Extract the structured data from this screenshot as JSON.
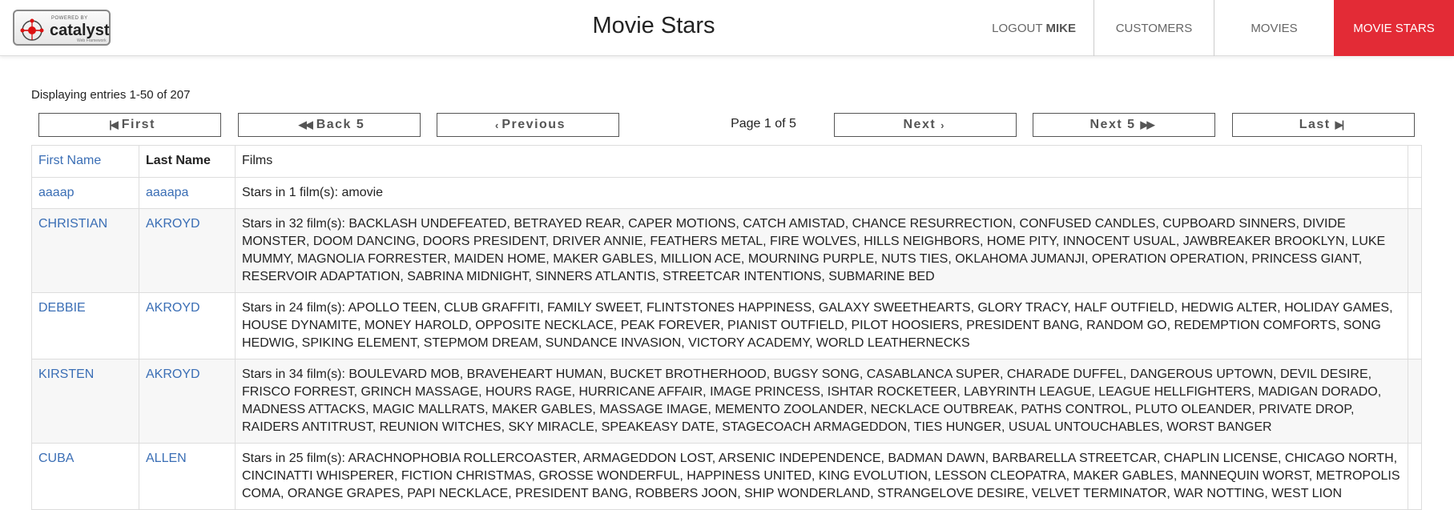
{
  "header": {
    "logo": {
      "powered": "POWERED BY",
      "name": "catalyst",
      "sub": "Web Framework"
    },
    "title": "Movie Stars",
    "nav": {
      "logout": "LOGOUT",
      "user": "MIKE",
      "customers": "CUSTOMERS",
      "movies": "MOVIES",
      "movie_stars": "MOVIE STARS"
    }
  },
  "summary": "Displaying entries 1-50 of 207",
  "pager": {
    "first": "First",
    "back5": "Back 5",
    "previous": "Previous",
    "page_label": "Page 1 of 5",
    "next": "Next",
    "next5": "Next 5",
    "last": "Last"
  },
  "table": {
    "headers": {
      "first_name": "First Name",
      "last_name": "Last Name",
      "films": "Films"
    },
    "rows": [
      {
        "first": "aaaap",
        "last": "aaaapa",
        "films": "Stars in 1 film(s): amovie"
      },
      {
        "first": "CHRISTIAN",
        "last": "AKROYD",
        "films": "Stars in 32 film(s): BACKLASH UNDEFEATED, BETRAYED REAR, CAPER MOTIONS, CATCH AMISTAD, CHANCE RESURRECTION, CONFUSED CANDLES, CUPBOARD SINNERS, DIVIDE MONSTER, DOOM DANCING, DOORS PRESIDENT, DRIVER ANNIE, FEATHERS METAL, FIRE WOLVES, HILLS NEIGHBORS, HOME PITY, INNOCENT USUAL, JAWBREAKER BROOKLYN, LUKE MUMMY, MAGNOLIA FORRESTER, MAIDEN HOME, MAKER GABLES, MILLION ACE, MOURNING PURPLE, NUTS TIES, OKLAHOMA JUMANJI, OPERATION OPERATION, PRINCESS GIANT, RESERVOIR ADAPTATION, SABRINA MIDNIGHT, SINNERS ATLANTIS, STREETCAR INTENTIONS, SUBMARINE BED"
      },
      {
        "first": "DEBBIE",
        "last": "AKROYD",
        "films": "Stars in 24 film(s): APOLLO TEEN, CLUB GRAFFITI, FAMILY SWEET, FLINTSTONES HAPPINESS, GALAXY SWEETHEARTS, GLORY TRACY, HALF OUTFIELD, HEDWIG ALTER, HOLIDAY GAMES, HOUSE DYNAMITE, MONEY HAROLD, OPPOSITE NECKLACE, PEAK FOREVER, PIANIST OUTFIELD, PILOT HOOSIERS, PRESIDENT BANG, RANDOM GO, REDEMPTION COMFORTS, SONG HEDWIG, SPIKING ELEMENT, STEPMOM DREAM, SUNDANCE INVASION, VICTORY ACADEMY, WORLD LEATHERNECKS"
      },
      {
        "first": "KIRSTEN",
        "last": "AKROYD",
        "films": "Stars in 34 film(s): BOULEVARD MOB, BRAVEHEART HUMAN, BUCKET BROTHERHOOD, BUGSY SONG, CASABLANCA SUPER, CHARADE DUFFEL, DANGEROUS UPTOWN, DEVIL DESIRE, FRISCO FORREST, GRINCH MASSAGE, HOURS RAGE, HURRICANE AFFAIR, IMAGE PRINCESS, ISHTAR ROCKETEER, LABYRINTH LEAGUE, LEAGUE HELLFIGHTERS, MADIGAN DORADO, MADNESS ATTACKS, MAGIC MALLRATS, MAKER GABLES, MASSAGE IMAGE, MEMENTO ZOOLANDER, NECKLACE OUTBREAK, PATHS CONTROL, PLUTO OLEANDER, PRIVATE DROP, RAIDERS ANTITRUST, REUNION WITCHES, SKY MIRACLE, SPEAKEASY DATE, STAGECOACH ARMAGEDDON, TIES HUNGER, USUAL UNTOUCHABLES, WORST BANGER"
      },
      {
        "first": "CUBA",
        "last": "ALLEN",
        "films": "Stars in 25 film(s): ARACHNOPHOBIA ROLLERCOASTER, ARMAGEDDON LOST, ARSENIC INDEPENDENCE, BADMAN DAWN, BARBARELLA STREETCAR, CHAPLIN LICENSE, CHICAGO NORTH, CINCINATTI WHISPERER, FICTION CHRISTMAS, GROSSE WONDERFUL, HAPPINESS UNITED, KING EVOLUTION, LESSON CLEOPATRA, MAKER GABLES, MANNEQUIN WORST, METROPOLIS COMA, ORANGE GRAPES, PAPI NECKLACE, PRESIDENT BANG, ROBBERS JOON, SHIP WONDERLAND, STRANGELOVE DESIRE, VELVET TERMINATOR, WAR NOTTING, WEST LION"
      }
    ]
  },
  "colors": {
    "accent": "#e32b36",
    "link": "#3a6eb5"
  }
}
